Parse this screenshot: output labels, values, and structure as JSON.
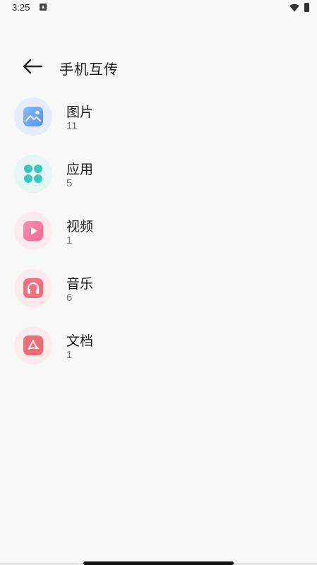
{
  "status_bar": {
    "time": "3:25",
    "icons": [
      "notification-icon",
      "wifi-icon",
      "battery-icon"
    ]
  },
  "header": {
    "title": "手机互传",
    "back_icon": "arrow-left-icon"
  },
  "categories": [
    {
      "label": "图片",
      "count": "11",
      "icon": "image-icon",
      "color": "#6aa6f0",
      "bg": "#e8ecfb"
    },
    {
      "label": "应用",
      "count": "5",
      "icon": "apps-icon",
      "color": "#3fcfc6",
      "bg": "#e6f6f5"
    },
    {
      "label": "视频",
      "count": "1",
      "icon": "play-icon",
      "color": "#f37aa0",
      "bg": "#fbecef"
    },
    {
      "label": "音乐",
      "count": "6",
      "icon": "headphones-icon",
      "color": "#f06f80",
      "bg": "#fcebed"
    },
    {
      "label": "文档",
      "count": "1",
      "icon": "pdf-icon",
      "color": "#f0707a",
      "bg": "#fcebec"
    }
  ]
}
